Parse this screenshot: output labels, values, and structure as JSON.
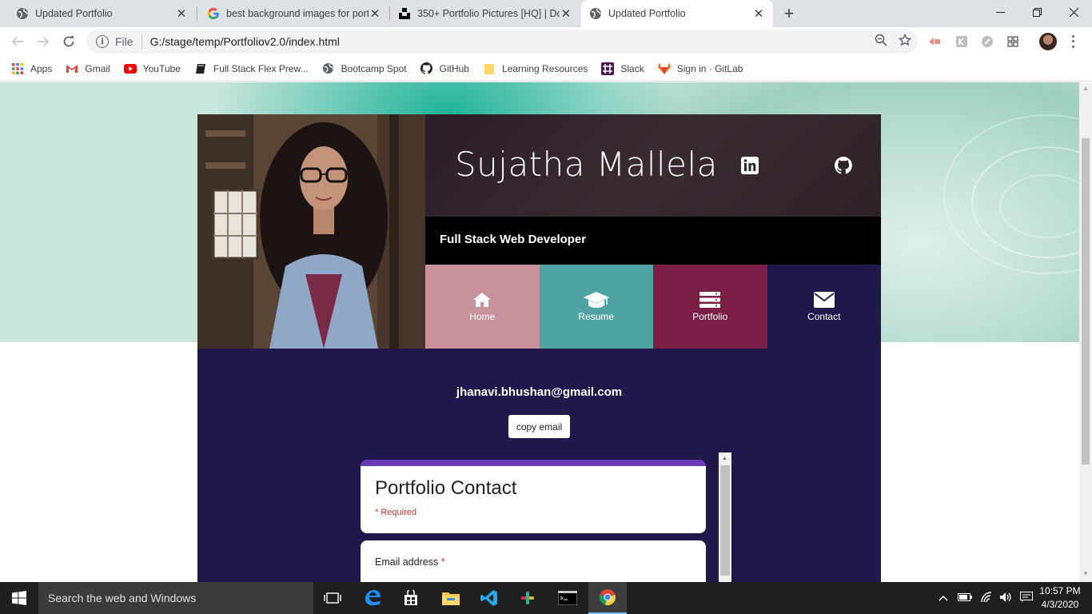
{
  "browser": {
    "tabs": [
      {
        "title": "Updated Portfolio",
        "active": false
      },
      {
        "title": "best background images for port",
        "active": false
      },
      {
        "title": "350+ Portfolio Pictures [HQ] | Do",
        "active": false
      },
      {
        "title": "Updated Portfolio",
        "active": true
      }
    ],
    "address": {
      "scheme": "File",
      "url": "G:/stage/temp/Portfoliov2.0/index.html"
    },
    "bookmarks": [
      {
        "label": "Apps",
        "icon": "apps-grid-icon"
      },
      {
        "label": "Gmail",
        "icon": "gmail-icon"
      },
      {
        "label": "YouTube",
        "icon": "youtube-icon"
      },
      {
        "label": "Full Stack Flex Prew...",
        "icon": "book-icon"
      },
      {
        "label": "Bootcamp Spot",
        "icon": "globe-icon"
      },
      {
        "label": "GitHub",
        "icon": "github-icon"
      },
      {
        "label": "Learning Resources",
        "icon": "folder-icon"
      },
      {
        "label": "Slack",
        "icon": "slack-icon"
      },
      {
        "label": "Sign in · GitLab",
        "icon": "gitlab-icon"
      }
    ]
  },
  "page": {
    "name": "Sujatha Mallela",
    "subtitle": "Full Stack Web Developer",
    "nav": [
      {
        "label": "Home",
        "icon": "home-icon",
        "color": "#c9919c"
      },
      {
        "label": "Resume",
        "icon": "graduation-cap-icon",
        "color": "#4fa3a3"
      },
      {
        "label": "Portfolio",
        "icon": "server-stack-icon",
        "color": "#7a1e45"
      },
      {
        "label": "Contact",
        "icon": "envelope-icon",
        "color": "#20174a"
      }
    ],
    "email": "jhanavi.bhushan@gmail.com",
    "copy_button": "copy email",
    "form": {
      "title": "Portfolio Contact",
      "required_note": "* Required",
      "question_label": "Email address",
      "question_star": "*"
    }
  },
  "taskbar": {
    "search_placeholder": "Search the web and Windows",
    "time": "10:57 PM",
    "date": "4/3/2020"
  },
  "colors": {
    "card_bg": "#20174a",
    "form_accent": "#673ab7",
    "required_red": "#d93025"
  }
}
